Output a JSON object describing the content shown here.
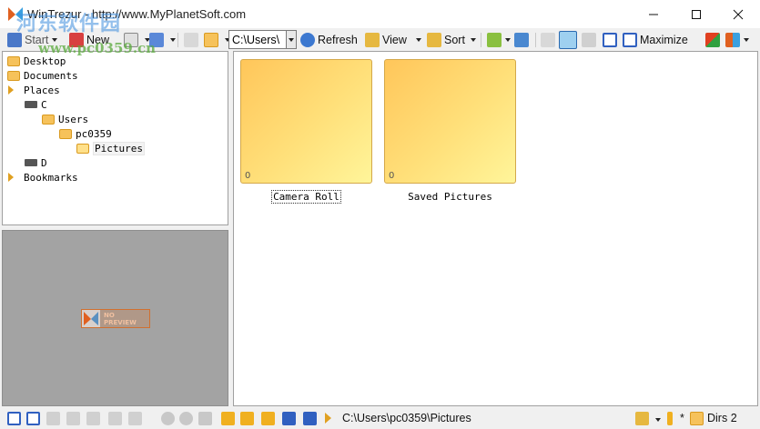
{
  "window": {
    "title": "WinTrezur - http://www.MyPlanetSoft.com",
    "watermark": "河东软件园",
    "watermark_url": "www.pc0359.cn"
  },
  "toolbar": {
    "start_label": "Start",
    "new_label": "New",
    "path_value": "C:\\Users\\",
    "refresh_label": "Refresh",
    "view_label": "View",
    "sort_label": "Sort",
    "maximize_label": "Maximize"
  },
  "tree": {
    "items": [
      {
        "label": "Desktop",
        "kind": "folder"
      },
      {
        "label": "Documents",
        "kind": "folder"
      },
      {
        "label": "Places",
        "kind": "arrow"
      },
      {
        "label": "C",
        "kind": "drive"
      },
      {
        "label": "Users",
        "kind": "folder"
      },
      {
        "label": "pc0359",
        "kind": "folder"
      },
      {
        "label": "Pictures",
        "kind": "folder-open"
      },
      {
        "label": "D",
        "kind": "drive"
      },
      {
        "label": "Bookmarks",
        "kind": "arrow"
      }
    ]
  },
  "preview": {
    "no_preview_text": "NO PREVIEW"
  },
  "content": {
    "items": [
      {
        "label": "Camera Roll",
        "count": "0"
      },
      {
        "label": "Saved Pictures",
        "count": "0"
      }
    ]
  },
  "status": {
    "path": "C:\\Users\\pc0359\\Pictures",
    "asterisk": "*",
    "dirs": "Dirs 2"
  },
  "colors": {
    "folder": "#f6c25b",
    "accent": "#e06020",
    "nav_gold": "#f0b020",
    "nav_blue": "#3060c0"
  }
}
